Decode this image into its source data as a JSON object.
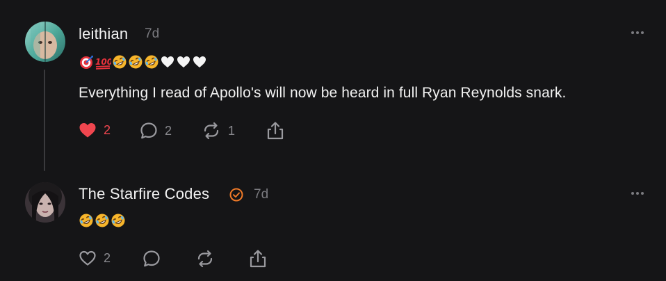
{
  "posts": [
    {
      "author": "leithian",
      "time": "7d",
      "text": "Everything I read of Apollo's will now be heard in full Ryan Reynolds snark.",
      "emojis": [
        "dart",
        "hundred",
        "rofl",
        "rofl",
        "rofl",
        "white-heart",
        "white-heart",
        "white-heart"
      ],
      "likes": "2",
      "liked": true,
      "replies": "2",
      "reposts": "1"
    },
    {
      "author": "The Starfire Codes",
      "time": "7d",
      "verified": true,
      "emojis": [
        "rofl",
        "rofl",
        "rofl"
      ],
      "likes": "2"
    }
  ],
  "colors": {
    "background": "#151517",
    "like_red": "#f0464f",
    "verified_orange": "#f07a28",
    "muted": "#7b7b80"
  }
}
